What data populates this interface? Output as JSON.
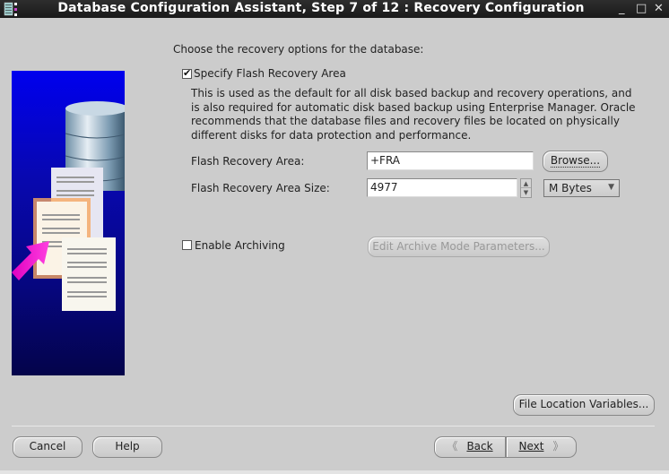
{
  "window": {
    "title": "Database Configuration Assistant, Step 7 of 12 : Recovery Configuration",
    "controls": {
      "minimize": "_",
      "maximize": "□",
      "close": "✕"
    }
  },
  "content": {
    "intro": "Choose the recovery options for the database:",
    "flash_recovery": {
      "checkbox_label": "Specify Flash Recovery Area",
      "checked": true,
      "description": "This is used as the default for all disk based backup and recovery operations, and is also required for automatic disk based backup using Enterprise Manager. Oracle recommends that the database files and recovery files be located on physically different disks for data protection and performance.",
      "area_label": "Flash Recovery Area:",
      "area_value": "+FRA",
      "browse_label": "Browse...",
      "size_label": "Flash Recovery Area Size:",
      "size_value": "4977",
      "size_unit": "M Bytes"
    },
    "archiving": {
      "checkbox_label": "Enable Archiving",
      "checked": false,
      "edit_params_label": "Edit Archive Mode Parameters..."
    },
    "file_location_variables_label": "File Location Variables..."
  },
  "footer": {
    "cancel": "Cancel",
    "help": "Help",
    "back": "Back",
    "next": "Next",
    "back_icon": "《",
    "next_icon": "》"
  }
}
